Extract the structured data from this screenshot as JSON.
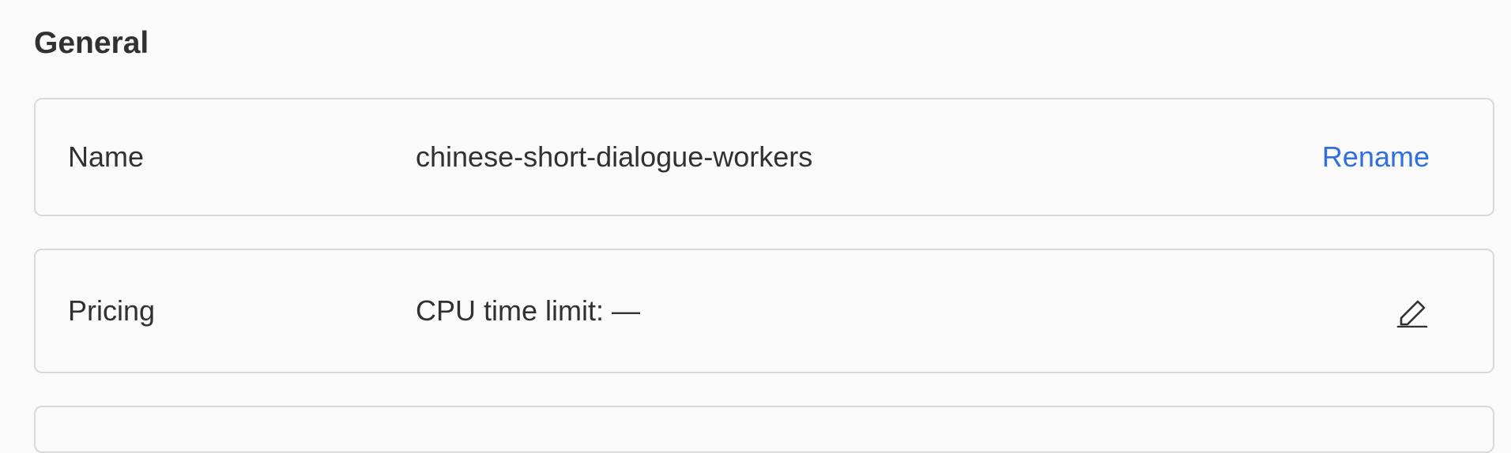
{
  "section": {
    "title": "General"
  },
  "name_row": {
    "label": "Name",
    "value": "chinese-short-dialogue-workers",
    "action_label": "Rename"
  },
  "pricing_row": {
    "label": "Pricing",
    "value": "CPU time limit: —",
    "action_icon": "edit-pencil-icon"
  },
  "colors": {
    "accent": "#2f6fe0",
    "text": "#313131",
    "border": "#d9d9d9",
    "background": "#fafafa"
  }
}
